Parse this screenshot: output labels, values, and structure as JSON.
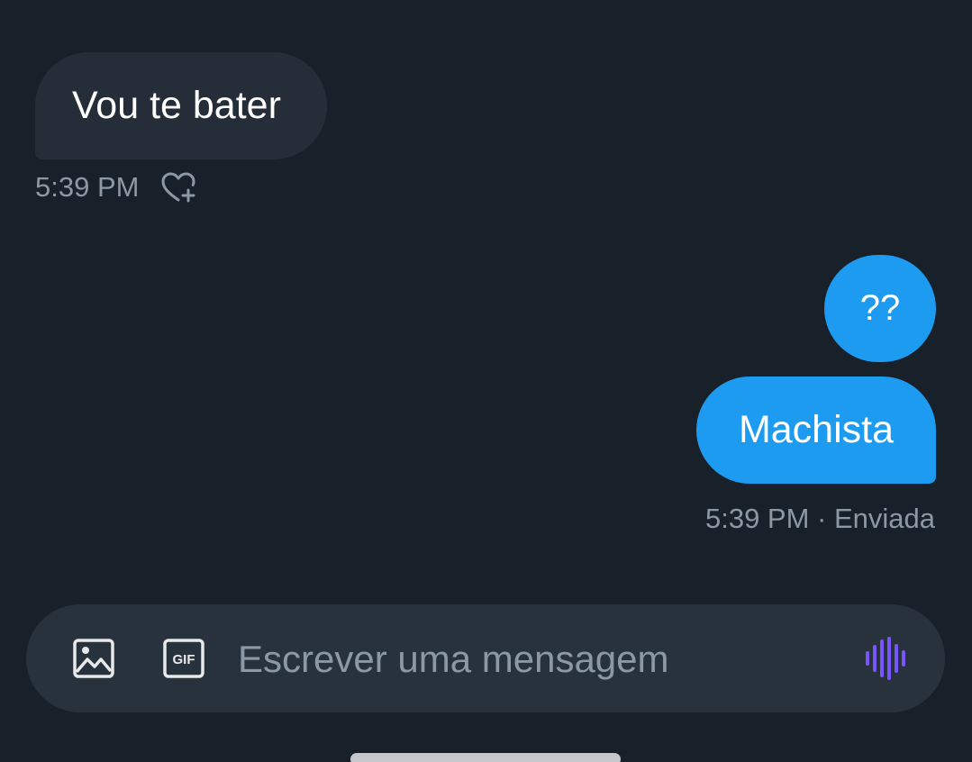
{
  "conversation": {
    "messages": [
      {
        "direction": "received",
        "text": "Vou te bater"
      },
      {
        "direction": "sent",
        "text": "??"
      },
      {
        "direction": "sent",
        "text": "Machista"
      }
    ],
    "received_meta": {
      "time": "5:39 PM",
      "reaction_icon": "heart-plus-icon"
    },
    "sent_meta": {
      "status": "5:39 PM · Enviada"
    }
  },
  "composer": {
    "placeholder": "Escrever uma mensagem",
    "value": "",
    "media_icon": "image-icon",
    "gif_label": "GIF",
    "voice_icon": "voice-waveform-icon"
  },
  "colors": {
    "background": "#18202a",
    "received_bubble": "#252e38",
    "sent_bubble": "#1d9bf0",
    "meta_text": "#8b98a5",
    "composer_bg": "#27323d",
    "voice_accent": "#7856ff"
  }
}
